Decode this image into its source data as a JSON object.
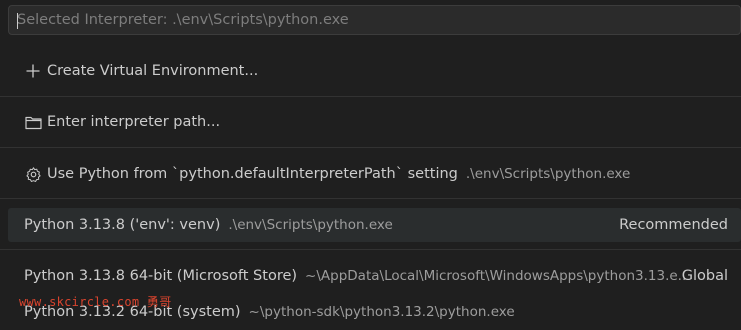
{
  "quick_pick": {
    "placeholder": "Selected Interpreter: .\\env\\Scripts\\python.exe"
  },
  "actions": [
    {
      "label": "Create Virtual Environment...",
      "icon": "plus-icon"
    },
    {
      "label": "Enter interpreter path...",
      "icon": "folder-icon"
    },
    {
      "label": "Use Python from `python.defaultInterpreterPath` setting",
      "description": ".\\env\\Scripts\\python.exe",
      "icon": "gear-icon"
    }
  ],
  "interpreters": [
    {
      "label": "Python 3.13.8 ('env': venv)",
      "description": ".\\env\\Scripts\\python.exe",
      "tag": "Recommended"
    },
    {
      "label": "Python 3.13.8 64-bit (Microsoft Store)",
      "description": "~\\AppData\\Local\\Microsoft\\WindowsApps\\python3.13.e...",
      "tag": "Global"
    },
    {
      "label": "Python 3.13.2 64-bit (system)",
      "description": "~\\python-sdk\\python3.13.2\\python.exe",
      "tag": ""
    }
  ],
  "watermark": "www.skcircle.com 勇哥",
  "colors": {
    "background": "#1f1f1f",
    "selected_row": "#2a2d2e",
    "text": "#cccccc",
    "description": "#9d9d9d"
  }
}
